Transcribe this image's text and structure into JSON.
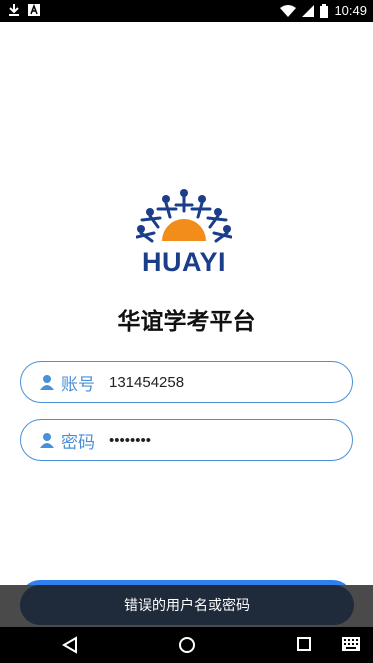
{
  "status_bar": {
    "time": "10:49",
    "left_icons": [
      "download-icon",
      "a-icon"
    ],
    "right_icons": [
      "wifi-icon",
      "signal-icon",
      "battery-icon"
    ]
  },
  "logo": {
    "text": "HUAYI"
  },
  "app_title": "华谊学考平台",
  "form": {
    "account": {
      "label": "账号",
      "value": "131454258"
    },
    "password": {
      "label": "密码",
      "value": "••••••••"
    }
  },
  "toast": {
    "message": "错误的用户名或密码"
  },
  "colors": {
    "accent": "#4a90d9",
    "logo_blue": "#1b3e8a",
    "logo_orange": "#f28c1b",
    "button": "#2f80ed"
  },
  "nav_bar": {
    "buttons": [
      "back-icon",
      "home-icon",
      "recents-icon",
      "keyboard-icon"
    ]
  }
}
